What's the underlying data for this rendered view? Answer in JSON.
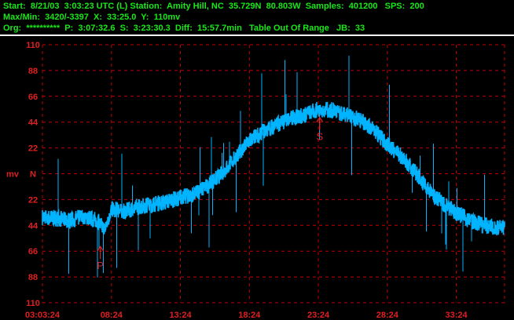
{
  "header": {
    "line1": "Start:  8/21/03  3:03:23 UTC (L) Station:  Amity Hill, NC  35.729N  80.803W  Samples:  401200   SPS:  200",
    "line2": "Max/Min:  3420/-3397  X:  33:25.0  Y:  110mv",
    "line3": "Org:  **********  P:  3:07:32.6  S:  3:23:30.3  Diff:  15:57.7min   Table Out Of Range   JB:  33"
  },
  "colors": {
    "header_text": "#18e818",
    "axis_text": "#e02020",
    "grid": "#c00000",
    "trace": "#00b4ff",
    "marker": "#e02020"
  },
  "chart_data": {
    "type": "line",
    "ylabel": "mv",
    "y_tick_values": [
      110,
      88,
      66,
      44,
      22,
      0,
      -22,
      -44,
      -66,
      -88,
      -110
    ],
    "y_tick_labels": [
      "110",
      "88",
      "66",
      "44",
      "22",
      "N",
      "22",
      "44",
      "66",
      "88",
      "110"
    ],
    "ylim": [
      -110,
      110
    ],
    "x_tick_labels": [
      "03:03:24",
      "08:24",
      "13:24",
      "18:24",
      "23:24",
      "28:24",
      "33:24"
    ],
    "x_tick_minutes": [
      0,
      5,
      10,
      15,
      20,
      25,
      30
    ],
    "xlim_minutes": [
      0,
      33.5
    ],
    "grid": true,
    "series": [
      {
        "x_minutes": [
          0,
          1,
          2,
          3,
          4,
          4.5,
          5,
          6,
          7,
          8,
          9,
          10,
          11,
          12,
          13,
          14,
          15,
          16,
          17,
          18,
          19,
          20,
          21,
          22,
          23,
          24,
          25,
          26,
          27,
          28,
          29,
          30,
          31,
          32,
          33,
          33.5
        ],
        "y_mv": [
          -37,
          -38,
          -40,
          -36,
          -40,
          -48,
          -30,
          -32,
          -28,
          -26,
          -24,
          -20,
          -18,
          -10,
          0,
          14,
          28,
          36,
          42,
          47,
          50,
          55,
          54,
          50,
          46,
          38,
          25,
          15,
          2,
          -14,
          -25,
          -33,
          -40,
          -44,
          -46,
          -46
        ]
      }
    ],
    "annotations": [
      {
        "label": "P",
        "x_minutes": 4.2,
        "y_mv": -62,
        "direction": "up"
      },
      {
        "label": "S",
        "x_minutes": 20.1,
        "y_mv": 48,
        "direction": "up"
      }
    ]
  }
}
